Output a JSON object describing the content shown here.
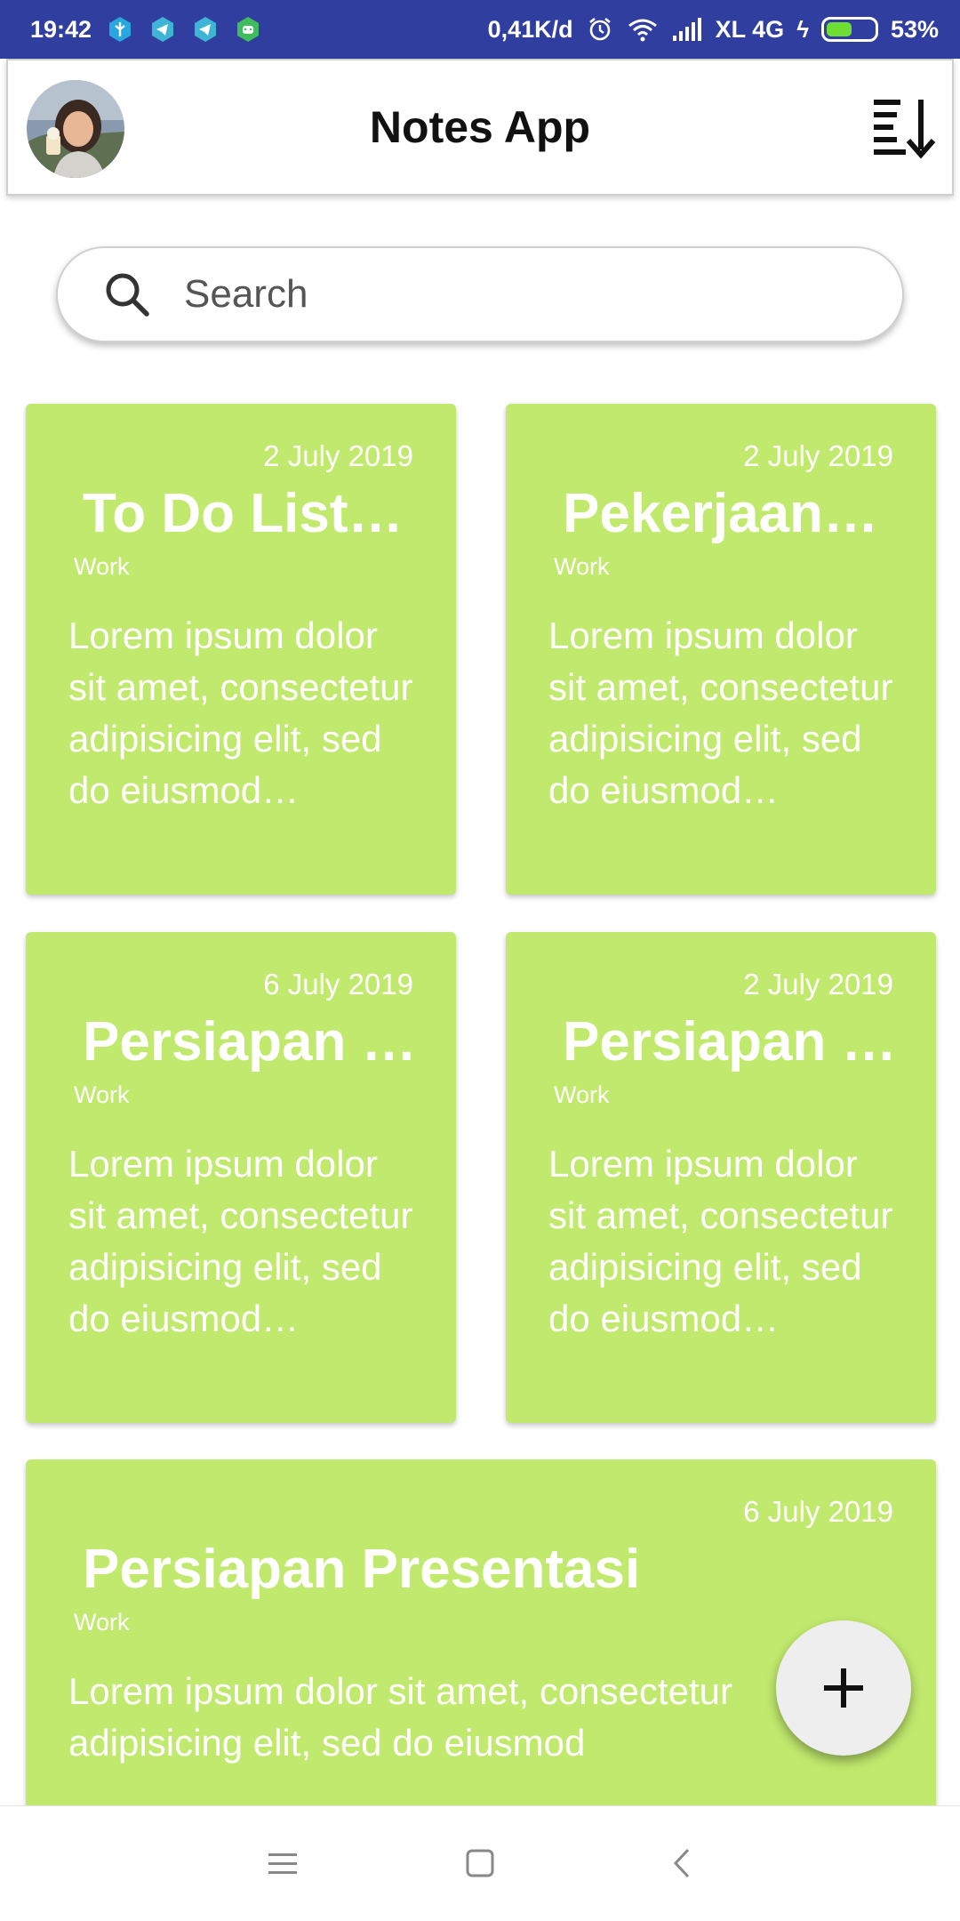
{
  "status_bar": {
    "time": "19:42",
    "network_speed": "0,41K/d",
    "carrier": "XL 4G",
    "battery": "53%",
    "battery_level": 0.53,
    "notification_icons": [
      "shield-icon",
      "telegram-icon",
      "telegram-icon",
      "android-icon"
    ]
  },
  "app_bar": {
    "title": "Notes App",
    "avatar_icon": "user-avatar",
    "sort_icon": "sort-descending-icon"
  },
  "search": {
    "placeholder": "Search",
    "value": ""
  },
  "notes": [
    {
      "date": "2 July 2019",
      "title": "To Do List…",
      "tag": "Work",
      "body": " Lorem ipsum dolor sit amet, consectetur adipisicing elit, sed do eiusmod…"
    },
    {
      "date": "2 July 2019",
      "title": "Pekerjaan…",
      "tag": "Work",
      "body": " Lorem ipsum dolor sit amet, consectetur adipisicing elit, sed do eiusmod…"
    },
    {
      "date": "6 July 2019",
      "title": "Persiapan P…",
      "tag": "Work",
      "body": " Lorem ipsum dolor sit amet, consectetur adipisicing elit, sed do eiusmod…"
    },
    {
      "date": "2 July 2019",
      "title": "Persiapan P…",
      "tag": "Work",
      "body": " Lorem ipsum dolor sit amet, consectetur adipisicing elit, sed do eiusmod…"
    },
    {
      "date": "6 July 2019",
      "title": "Persiapan Presentasi",
      "tag": "Work",
      "body": " Lorem ipsum dolor sit amet, consectetur adipisicing elit, sed do eiusmod"
    }
  ],
  "fab": {
    "icon": "plus-icon"
  },
  "nav_bar": {
    "icons": [
      "menu-icon",
      "home-square-icon",
      "back-chevron-icon"
    ]
  },
  "colors": {
    "status_bar": "#303f9f",
    "note_card": "#c1e96d",
    "note_text": "#ffffff",
    "fab": "#eeeeee"
  }
}
